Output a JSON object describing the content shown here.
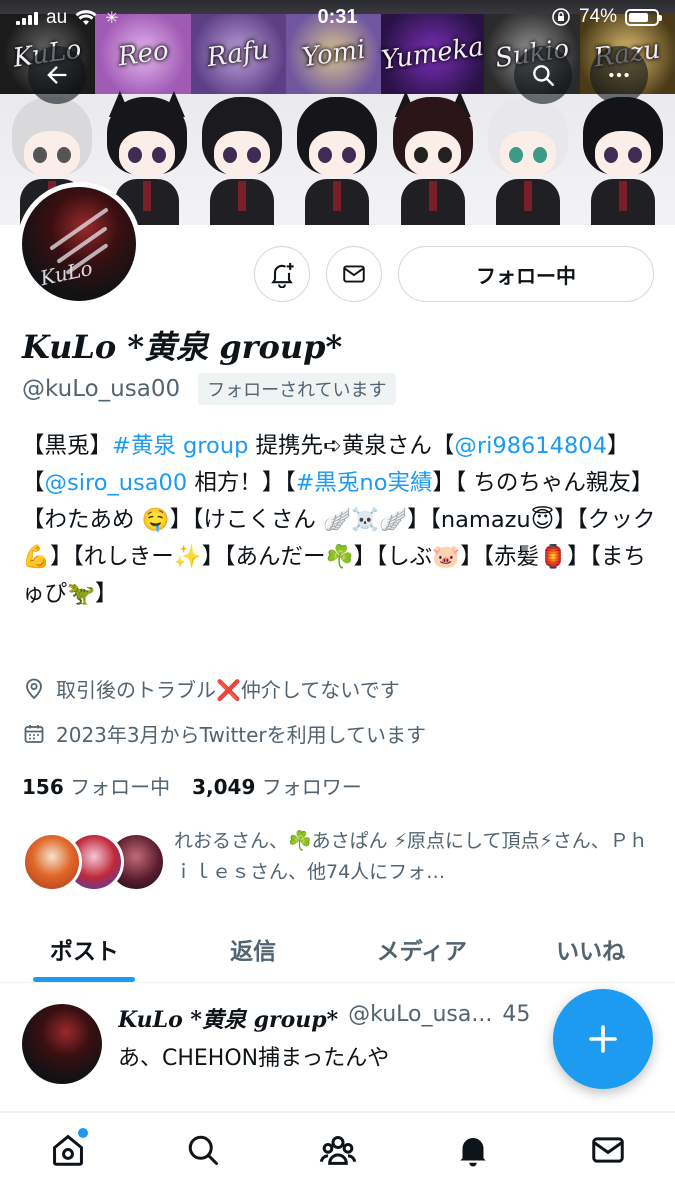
{
  "status_bar": {
    "carrier": "au",
    "time": "0:31",
    "battery": "74%",
    "battery_level": 0.74
  },
  "banner": {
    "names": [
      "KuLo",
      "Reo",
      "Rafu",
      "Yomi",
      "Yumeka",
      "Sukio",
      "Razu"
    ]
  },
  "profile": {
    "display_name": "KuLo *黄泉 group*",
    "handle": "@kuLo_usa00",
    "follows_you": "フォローされています",
    "follow_button": "フォロー中",
    "bio": {
      "p1": "【黒兎】",
      "l1": "#黄泉 group",
      "p2": " 提携先➪黄泉さん【",
      "l2": "@ri98614804",
      "p3": "】【",
      "l3": "@siro_usa00",
      "p4": " 相方！】【",
      "l4": "#黒兎no実績",
      "p5": "】【 ちのちゃん親友】【わたあめ 🤤】【けこくさん 🪽☠️🪽】【namazu😇】【クック💪】【れしきー✨】【あんだー☘️】【しぶ🐷】【赤髪🏮】【まちゅぴ🦖】"
    },
    "location": "取引後のトラブル❌仲介してないです",
    "joined": "2023年3月からTwitterを利用しています",
    "following_count": "156",
    "following_label": "フォロー中",
    "followers_count": "3,049",
    "followers_label": "フォロワー",
    "followed_by": "れおるさん、☘️あさぱん ⚡原点にして頂点⚡さん、Ｐｈｉｌｅｓさん、他74人にフォ…"
  },
  "tabs": [
    {
      "label": "ポスト",
      "active": true
    },
    {
      "label": "返信"
    },
    {
      "label": "メディア"
    },
    {
      "label": "いいね"
    }
  ],
  "post": {
    "name": "KuLo *黄泉 group*",
    "handle": "@kuLo_usa...",
    "time": "45",
    "text": "あ、CHEHON捕まったんや"
  },
  "colors": {
    "accent": "#1d9bf0",
    "text": "#0f1419",
    "muted": "#536471",
    "border": "#cfd9de"
  },
  "icons": [
    "back-arrow-icon",
    "search-icon",
    "more-icon",
    "notification-bell-plus-icon",
    "mail-icon",
    "location-icon",
    "calendar-icon",
    "compose-plus-icon",
    "home-icon",
    "explore-search-icon",
    "communities-icon",
    "notifications-icon",
    "messages-icon"
  ]
}
